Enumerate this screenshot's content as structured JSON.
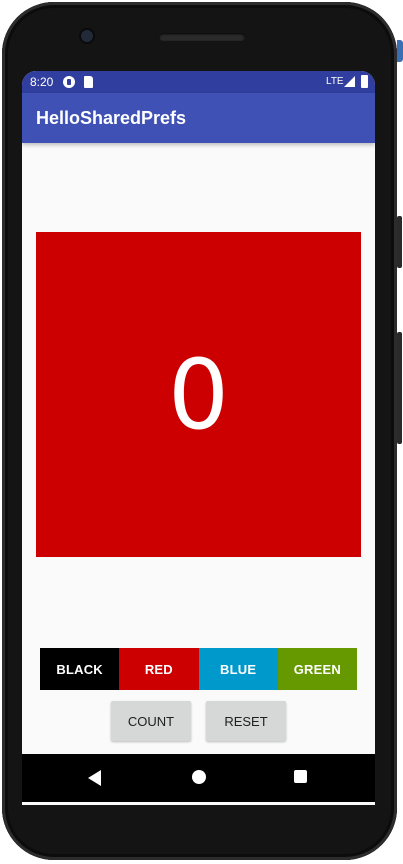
{
  "status_bar": {
    "time": "8:20",
    "network": "LTE"
  },
  "app_bar": {
    "title": "HelloSharedPrefs"
  },
  "counter": {
    "value": "0",
    "background_color": "#cc0000"
  },
  "color_buttons": [
    {
      "label": "BLACK",
      "color": "#000000"
    },
    {
      "label": "RED",
      "color": "#cc0000"
    },
    {
      "label": "BLUE",
      "color": "#0099cc"
    },
    {
      "label": "GREEN",
      "color": "#669900"
    }
  ],
  "actions": {
    "count_label": "COUNT",
    "reset_label": "RESET"
  },
  "colors": {
    "status_bar": "#303f9f",
    "app_bar": "#3f51b5",
    "screen_background": "#fafafa"
  }
}
